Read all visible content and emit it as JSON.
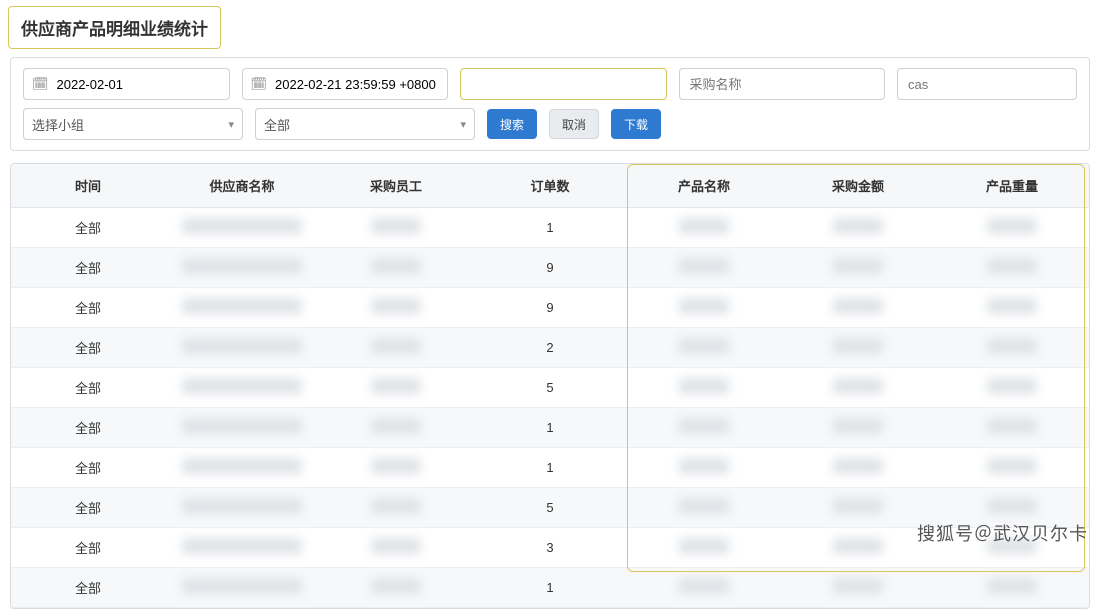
{
  "title": "供应商产品明细业绩统计",
  "filters": {
    "start_date": "2022-02-01",
    "end_date": "2022-02-21 23:59:59 +0800",
    "supplier_placeholder": "",
    "buyer_placeholder": "采购名称",
    "cas_placeholder": "cas",
    "team_label": "选择小组",
    "all_label": "全部"
  },
  "buttons": {
    "search": "搜索",
    "cancel": "取消",
    "download": "下载"
  },
  "columns": {
    "time": "时间",
    "supplier": "供应商名称",
    "buyer": "采购员工",
    "orders": "订单数",
    "product": "产品名称",
    "amount": "采购金额",
    "weight": "产品重量"
  },
  "rows": [
    {
      "time": "全部",
      "orders": "1"
    },
    {
      "time": "全部",
      "orders": "9"
    },
    {
      "time": "全部",
      "orders": "9"
    },
    {
      "time": "全部",
      "orders": "2"
    },
    {
      "time": "全部",
      "orders": "5"
    },
    {
      "time": "全部",
      "orders": "1"
    },
    {
      "time": "全部",
      "orders": "1"
    },
    {
      "time": "全部",
      "orders": "5"
    },
    {
      "time": "全部",
      "orders": "3"
    },
    {
      "time": "全部",
      "orders": "1"
    }
  ],
  "watermark": "搜狐号＠武汉贝尔卡"
}
